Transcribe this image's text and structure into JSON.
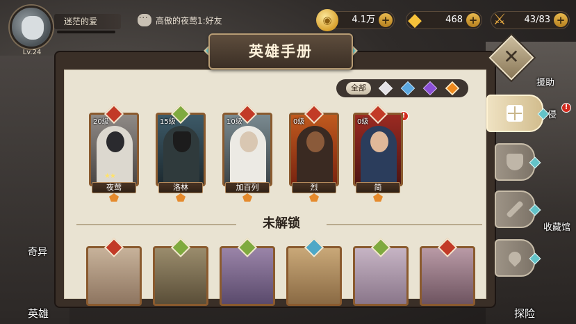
{
  "player": {
    "name": "迷茫的爱",
    "level": "Lv.24"
  },
  "chat": {
    "message": "高傲的夜莺1:好友"
  },
  "resources": {
    "gold": "4.1万",
    "gems": "468",
    "stamina": "43/83"
  },
  "panel": {
    "title": "英雄手册",
    "filter_all": "全部",
    "locked_section": "未解锁"
  },
  "side_menu": {
    "aid_label": "援助",
    "invade_label": "侵",
    "collection_label": "收藏馆",
    "explore_label": "探险",
    "heroes_label": "英雄",
    "odd_label": "奇异"
  },
  "heroes_unlocked": [
    {
      "level": "20级",
      "name": "夜莺",
      "stars": "★★",
      "badge": "red",
      "alert": ""
    },
    {
      "level": "15级",
      "name": "洛林",
      "stars": "",
      "badge": "green",
      "alert": ""
    },
    {
      "level": "10级",
      "name": "加百列",
      "stars": "",
      "badge": "red",
      "alert": ""
    },
    {
      "level": "0级",
      "name": "烈",
      "stars": "",
      "badge": "red",
      "alert": ""
    },
    {
      "level": "0级",
      "name": "简",
      "stars": "",
      "badge": "red",
      "alert": "!"
    }
  ],
  "heroes_locked": [
    {
      "badge": "red"
    },
    {
      "badge": "green"
    },
    {
      "badge": "green"
    },
    {
      "badge": "blue"
    },
    {
      "badge": "green"
    },
    {
      "badge": "red"
    }
  ],
  "colors": {
    "panel_bg": "#e9e3d2",
    "frame": "#8a5a2e",
    "accent_gold": "#e8b94e",
    "alert_red": "#d22a1e"
  }
}
